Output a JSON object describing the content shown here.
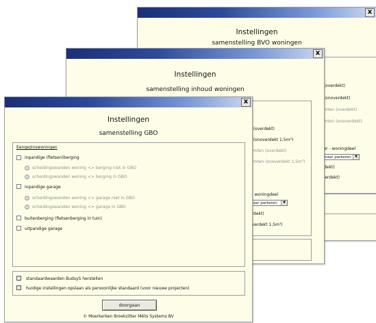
{
  "window1": {
    "heading": "Instellingen",
    "subheading": "samenstelling BVO woningen",
    "close_label": "x",
    "rows": [
      "n (overdekt)",
      "n (onoverdekt)",
      "uimten (overdekt)",
      "uimten (onoverdekt)",
      "g",
      "lder - woningdeel",
      "erdekt)",
      "overdekt)"
    ],
    "select_value": "naar parkeren",
    "select_arrow": "▼"
  },
  "window2": {
    "heading": "Instellingen",
    "subheading": "samenstelling inhoud woningen",
    "close_label": "x",
    "rows": [
      "n (overdekt)",
      "n (onoverdekt 1,5m³)",
      "uimten (overdekt)",
      "uimten (onoverdekt 1,5m³)",
      "g",
      "lder - woningdeel",
      "erdekt)",
      "overdekt 1,5m³)"
    ],
    "select_value": "naar parkeren",
    "select_arrow": "▼"
  },
  "window3": {
    "heading": "Instellingen",
    "subheading": "samenstelling GBO",
    "close_label": "x",
    "section_title": "Eengezinswoningen",
    "options": {
      "inpandige_berging": "inpandige (fietsen)berging",
      "radio_berging_niet": "scheidingswanden woning <> berging niet in GBO",
      "radio_berging_in": "scheidingswanden woning <> berging in GBO",
      "inpandige_garage": "inpandige garage",
      "radio_garage_niet": "scheidingswanden woning <> garage niet in GBO",
      "radio_garage_in": "scheidingswanden woning <> garage in GBO",
      "buitenberging": "buitenberging (fietsenberging in tuin)",
      "uitpandige_garage": "uitpandige garage"
    },
    "bottom": {
      "restore_label": "standaardwaarden BudsyS herstellen",
      "save_label": "huidige instellingen opslaan als persoonlijke standaard (voor nieuwe projecten)"
    },
    "continue_button": "doorgaan",
    "copyright": "© Moerkerken Broekzitter Mëlis Systems BV"
  }
}
